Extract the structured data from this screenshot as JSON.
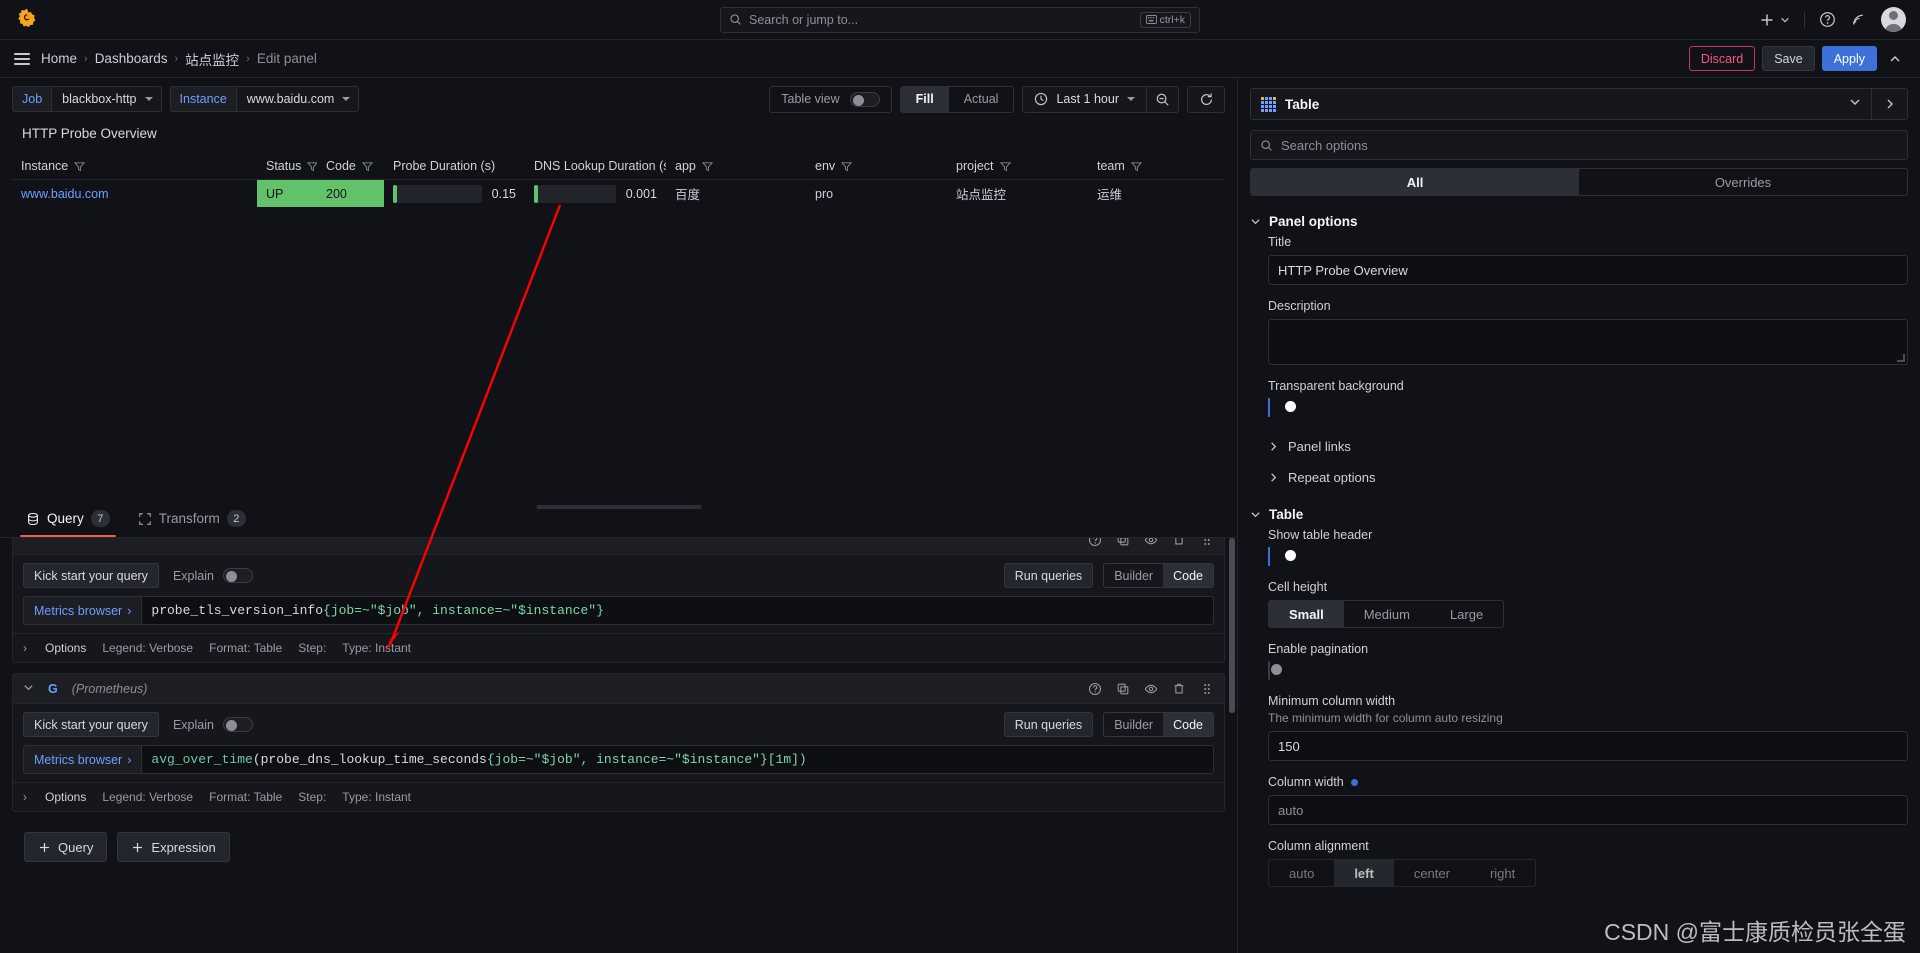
{
  "topnav": {
    "logo_icon": "grafana-logo-icon",
    "search_placeholder": "Search or jump to...",
    "search_shortcut": "ctrl+k",
    "plus_icon": "plus-icon",
    "help_icon": "help-circle-icon",
    "news_icon": "news-rss-icon",
    "avatar_icon": "user-avatar-icon"
  },
  "breadcrumb": {
    "menu_icon": "hamburger-menu-icon",
    "items": [
      {
        "label": "Home",
        "current": false
      },
      {
        "label": "Dashboards",
        "current": false
      },
      {
        "label": "站点监控",
        "current": false
      },
      {
        "label": "Edit panel",
        "current": true
      }
    ],
    "discard_label": "Discard",
    "save_label": "Save",
    "apply_label": "Apply",
    "collapse_icon": "chevron-up-icon"
  },
  "subtoolbar": {
    "variables": [
      {
        "label": "Job",
        "value": "blackbox-http"
      },
      {
        "label": "Instance",
        "value": "www.baidu.com"
      }
    ],
    "table_view_label": "Table view",
    "table_view_on": false,
    "fill_label": "Fill",
    "actual_label": "Actual",
    "fill_active": true,
    "time_range": "Last 1 hour",
    "clock_icon": "clock-icon",
    "zoom_out_icon": "zoom-out-icon",
    "refresh_icon": "refresh-icon"
  },
  "panel": {
    "title": "HTTP Probe Overview",
    "columns": [
      {
        "label": "Instance",
        "filter": true
      },
      {
        "label": "Status",
        "filter": true
      },
      {
        "label": "Code",
        "filter": true
      },
      {
        "label": "Probe Duration (s)",
        "filter": false
      },
      {
        "label": "DNS Lookup Duration (s",
        "filter": false
      },
      {
        "label": "app",
        "filter": true
      },
      {
        "label": "env",
        "filter": true
      },
      {
        "label": "project",
        "filter": true
      },
      {
        "label": "team",
        "filter": true
      }
    ],
    "rows": [
      {
        "instance": "www.baidu.com",
        "status": "UP",
        "code": "200",
        "probe_duration": "0.15",
        "probe_duration_pct": 4,
        "dns_duration": "0.001",
        "dns_duration_pct": 4,
        "app": "百度",
        "env": "pro",
        "project": "站点监控",
        "team": "运维"
      }
    ],
    "status_color": "#61c26a"
  },
  "query_pane": {
    "tabs": [
      {
        "label": "Query",
        "count": "7",
        "icon": "database-icon",
        "active": true
      },
      {
        "label": "Transform",
        "count": "2",
        "icon": "transform-icon",
        "active": false
      }
    ],
    "queries": [
      {
        "letter": "",
        "datasource": "",
        "kick_start_label": "Kick start your query",
        "explain_label": "Explain",
        "explain_on": false,
        "run_label": "Run queries",
        "builder_label": "Builder",
        "code_label": "Code",
        "mode": "Code",
        "metrics_browser_label": "Metrics browser",
        "expr_fn": "",
        "expr_metric": "probe_tls_version_info",
        "expr_tail": "{job=~\"$job\", instance=~\"$instance\"}",
        "options_label": "Options",
        "legend": "Legend: Verbose",
        "format": "Format: Table",
        "step": "Step:",
        "type": "Type: Instant"
      },
      {
        "letter": "G",
        "datasource": "(Prometheus)",
        "kick_start_label": "Kick start your query",
        "explain_label": "Explain",
        "explain_on": false,
        "run_label": "Run queries",
        "builder_label": "Builder",
        "code_label": "Code",
        "mode": "Code",
        "metrics_browser_label": "Metrics browser",
        "expr_fn": "avg_over_time",
        "expr_metric": "probe_dns_lookup_time_seconds",
        "expr_tail": "{job=~\"$job\", instance=~\"$instance\"}[1m])",
        "options_label": "Options",
        "legend": "Legend: Verbose",
        "format": "Format: Table",
        "step": "Step:",
        "type": "Type: Instant"
      }
    ],
    "add_query_label": "Query",
    "add_expression_label": "Expression",
    "row_icons": [
      "help-circle-icon",
      "duplicate-icon",
      "eye-icon",
      "trash-icon",
      "drag-handle-icon"
    ]
  },
  "options": {
    "viz_name": "Table",
    "viz_icon": "table-icon",
    "search_placeholder": "Search options",
    "tab_all": "All",
    "tab_overrides": "Overrides",
    "panel_options_title": "Panel options",
    "title_label": "Title",
    "title_value": "HTTP Probe Overview",
    "description_label": "Description",
    "description_value": "",
    "transparent_label": "Transparent background",
    "transparent_on": true,
    "panel_links_label": "Panel links",
    "repeat_options_label": "Repeat options",
    "table_section_title": "Table",
    "show_header_label": "Show table header",
    "show_header_on": true,
    "cell_height_label": "Cell height",
    "cell_height_options": [
      "Small",
      "Medium",
      "Large"
    ],
    "cell_height_selected": "Small",
    "pagination_label": "Enable pagination",
    "pagination_on": false,
    "min_col_width_label": "Minimum column width",
    "min_col_width_desc": "The minimum width for column auto resizing",
    "min_col_width_value": "150",
    "column_width_label": "Column width",
    "column_width_value": "auto",
    "column_alignment_label": "Column alignment"
  },
  "watermark": "CSDN @富士康质检员张全蛋"
}
